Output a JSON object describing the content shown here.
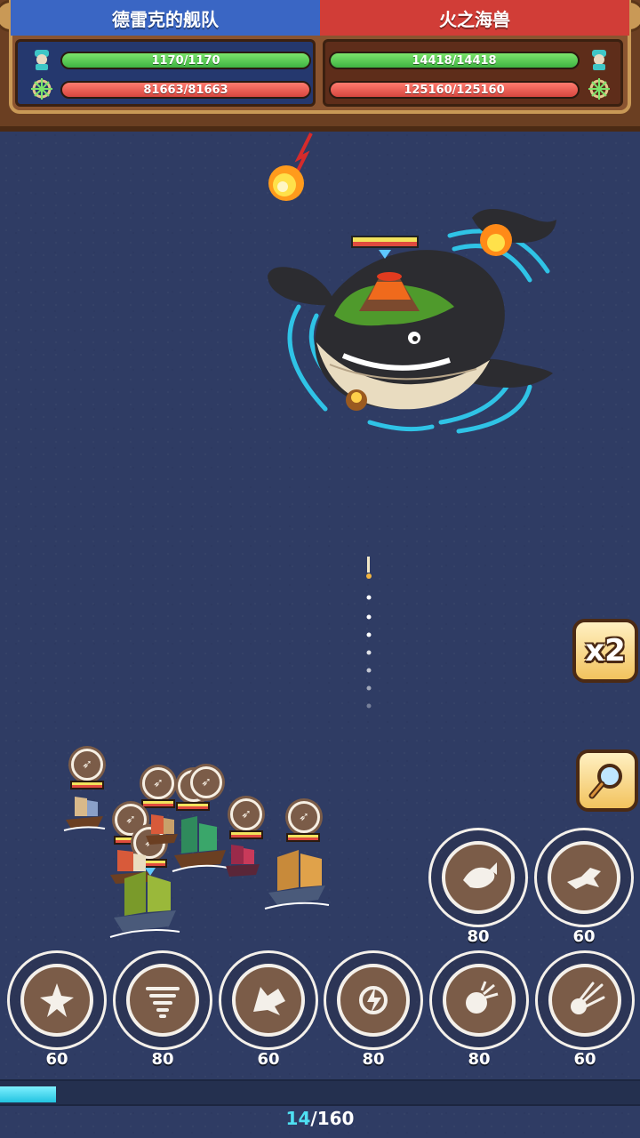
{
  "header": {
    "left_team": {
      "name": "德雷克的舰队",
      "captain_hp": "1170/1170",
      "fleet_hp": "81663/81663",
      "color": "#3a66c4"
    },
    "right_team": {
      "name": "火之海兽",
      "captain_hp": "14418/14418",
      "fleet_hp": "125160/125160",
      "color": "#d13d37"
    },
    "icons": {
      "captain": "pirate-captain-icon",
      "fleet": "ship-wheel-icon"
    }
  },
  "boss": {
    "name_icon": "volcano-whale",
    "hp_fraction": 1.0
  },
  "controls": {
    "speed_label": "x2",
    "zoom_icon": "magnifier-icon"
  },
  "skills_top": [
    {
      "icon": "whale-tail-icon",
      "cost": "80"
    },
    {
      "icon": "dash-creature-icon",
      "cost": "60"
    }
  ],
  "skills_bottom": [
    {
      "icon": "starburst-icon",
      "cost": "60"
    },
    {
      "icon": "tornado-icon",
      "cost": "80"
    },
    {
      "icon": "wolf-head-icon",
      "cost": "60"
    },
    {
      "icon": "lightning-orb-icon",
      "cost": "80"
    },
    {
      "icon": "explosion-icon",
      "cost": "80"
    },
    {
      "icon": "comet-icon",
      "cost": "60"
    }
  ],
  "progress": {
    "current": "14",
    "separator": "/",
    "total": "160",
    "fraction": 0.0875
  }
}
